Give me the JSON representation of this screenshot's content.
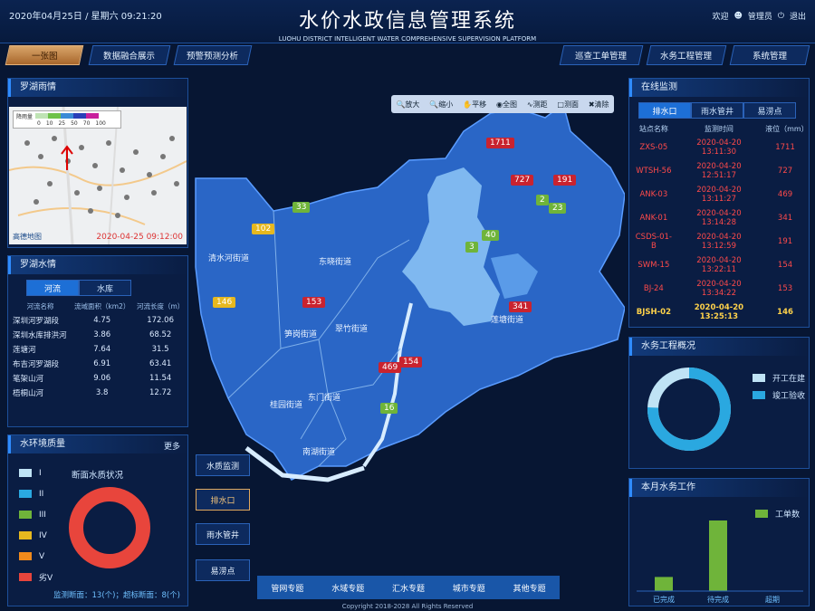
{
  "header": {
    "datetime": "2020年04月25日 / 星期六   09:21:20",
    "title": "水价水政信息管理系统",
    "subtitle": "LUOHU DISTRICT INTELLIGENT WATER COMPREHENSIVE SUPERVISION PLATFORM",
    "welcome": "欢迎",
    "user": "管理员",
    "logout": "退出"
  },
  "tabs_left": [
    "一张图",
    "数据融合展示",
    "预警预测分析"
  ],
  "tabs_right": [
    "巡查工单管理",
    "水务工程管理",
    "系统管理"
  ],
  "rain": {
    "title": "罗湖雨情",
    "legend_label": "降雨量",
    "legend_ticks": [
      "0",
      "10",
      "25",
      "50",
      "70",
      "100"
    ],
    "timestamp": "2020-04-25 09:12:00",
    "brand": "高德地图"
  },
  "water": {
    "title": "罗湖水情",
    "tabs": [
      "河流",
      "水库"
    ],
    "headers": [
      "河流名称",
      "流域面积（km2）",
      "河流长度（m）"
    ],
    "rows": [
      [
        "深圳河罗湖段",
        "4.75",
        "172.06"
      ],
      [
        "深圳水库排洪河",
        "3.86",
        "68.52"
      ],
      [
        "莲塘河",
        "7.64",
        "31.5"
      ],
      [
        "布吉河罗湖段",
        "6.91",
        "63.41"
      ],
      [
        "笔架山河",
        "9.06",
        "11.54"
      ],
      [
        "梧桐山河",
        "3.8",
        "12.72"
      ]
    ]
  },
  "quality": {
    "title": "水环境质量",
    "more": "更多",
    "chart_title": "断面水质状况",
    "legend": [
      {
        "label": "I",
        "color": "#bfe3f5"
      },
      {
        "label": "II",
        "color": "#2aa8e0"
      },
      {
        "label": "III",
        "color": "#6fb43a"
      },
      {
        "label": "IV",
        "color": "#e6b81f"
      },
      {
        "label": "V",
        "color": "#f08a1c"
      },
      {
        "label": "劣V",
        "color": "#e8453c"
      }
    ],
    "footer": "监测断面：13(个)；超标断面：8(个)"
  },
  "toolbar": [
    "放大",
    "缩小",
    "平移",
    "全图",
    "测距",
    "测面",
    "清除"
  ],
  "side_buttons": [
    "水质监测",
    "排水口",
    "雨水管井",
    "易涝点"
  ],
  "bottom_tabs": [
    "管网专题",
    "水域专题",
    "汇水专题",
    "城市专题",
    "其他专题"
  ],
  "copyright": "Copyright 2018-2028 All Rights Reserved",
  "districts": [
    "清水河街道",
    "东晓街道",
    "笋岗街道",
    "翠竹街道",
    "东门街道",
    "桂园街道",
    "南湖街道",
    "莲塘街道"
  ],
  "markers": [
    {
      "label": "1711",
      "type": "red"
    },
    {
      "label": "727",
      "type": "red"
    },
    {
      "label": "191",
      "type": "red"
    },
    {
      "label": "2",
      "type": "green"
    },
    {
      "label": "23",
      "type": "green"
    },
    {
      "label": "33",
      "type": "green"
    },
    {
      "label": "102",
      "type": "yellow"
    },
    {
      "label": "3",
      "type": "green"
    },
    {
      "label": "40",
      "type": "green"
    },
    {
      "label": "146",
      "type": "yellow"
    },
    {
      "label": "153",
      "type": "red"
    },
    {
      "label": "341",
      "type": "red"
    },
    {
      "label": "469",
      "type": "red"
    },
    {
      "label": "154",
      "type": "red"
    },
    {
      "label": "16",
      "type": "green"
    }
  ],
  "monitor": {
    "title": "在线监测",
    "tabs": [
      "排水口",
      "雨水管井",
      "易涝点"
    ],
    "headers": [
      "站点名称",
      "监测时间",
      "液位（mm）"
    ],
    "rows": [
      [
        "ZXS-05",
        "2020-04-20 13:11:30",
        "1711"
      ],
      [
        "WTSH-56",
        "2020-04-20 12:51:17",
        "727"
      ],
      [
        "ANK-03",
        "2020-04-20 13:11:27",
        "469"
      ],
      [
        "ANK-01",
        "2020-04-20 13:14:28",
        "341"
      ],
      [
        "CSDS-01-B",
        "2020-04-20 13:12:59",
        "191"
      ],
      [
        "SWM-15",
        "2020-04-20 13:22:11",
        "154"
      ],
      [
        "BJ-24",
        "2020-04-20 13:34:22",
        "153"
      ],
      [
        "BJSH-02",
        "2020-04-20 13:25:13",
        "146"
      ]
    ]
  },
  "projects": {
    "title": "水务工程概况",
    "legend": [
      {
        "label": "开工在建",
        "color": "#bfe3f5"
      },
      {
        "label": "竣工验收",
        "color": "#2aa8e0"
      }
    ]
  },
  "monthly": {
    "title": "本月水务工作",
    "legend": "工单数",
    "color": "#6fb43a"
  },
  "chart_data": {
    "type": "bar",
    "categories": [
      "已完成",
      "待完成",
      "超期"
    ],
    "values": [
      1,
      5,
      0
    ],
    "legend": [
      "工单数"
    ]
  }
}
